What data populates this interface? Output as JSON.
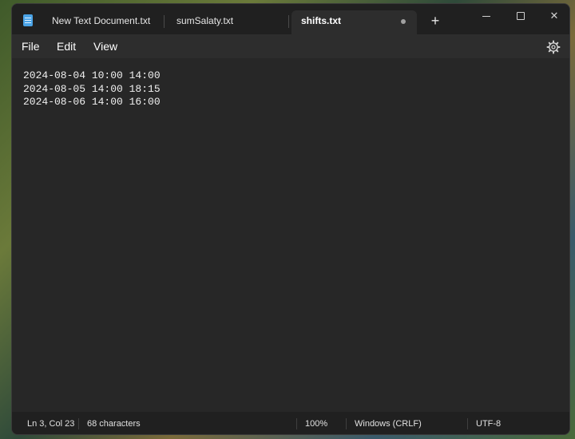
{
  "tabs": [
    {
      "label": "New Text Document.txt",
      "active": false
    },
    {
      "label": "sumSalaty.txt",
      "active": false
    },
    {
      "label": "shifts.txt",
      "active": true,
      "unsaved": true
    }
  ],
  "icons": {
    "app": "notepad-icon",
    "new_tab": "plus-icon",
    "minimize": "minimize-icon",
    "maximize": "maximize-icon",
    "close": "close-icon",
    "settings": "gear-icon"
  },
  "glyphs": {
    "new_tab": "+",
    "close": "✕"
  },
  "menu": {
    "file": "File",
    "edit": "Edit",
    "view": "View"
  },
  "editor": {
    "lines": [
      "2024-08-04 10:00 14:00",
      "2024-08-05 14:00 18:15",
      "2024-08-06 14:00 16:00"
    ]
  },
  "status": {
    "position": "Ln 3, Col 23",
    "characters": "68 characters",
    "zoom": "100%",
    "line_endings": "Windows (CRLF)",
    "encoding": "UTF-8"
  },
  "colors": {
    "background": "#272727",
    "titlebar": "#202020",
    "active_tab": "#2d2d2d",
    "text": "#ffffff"
  }
}
